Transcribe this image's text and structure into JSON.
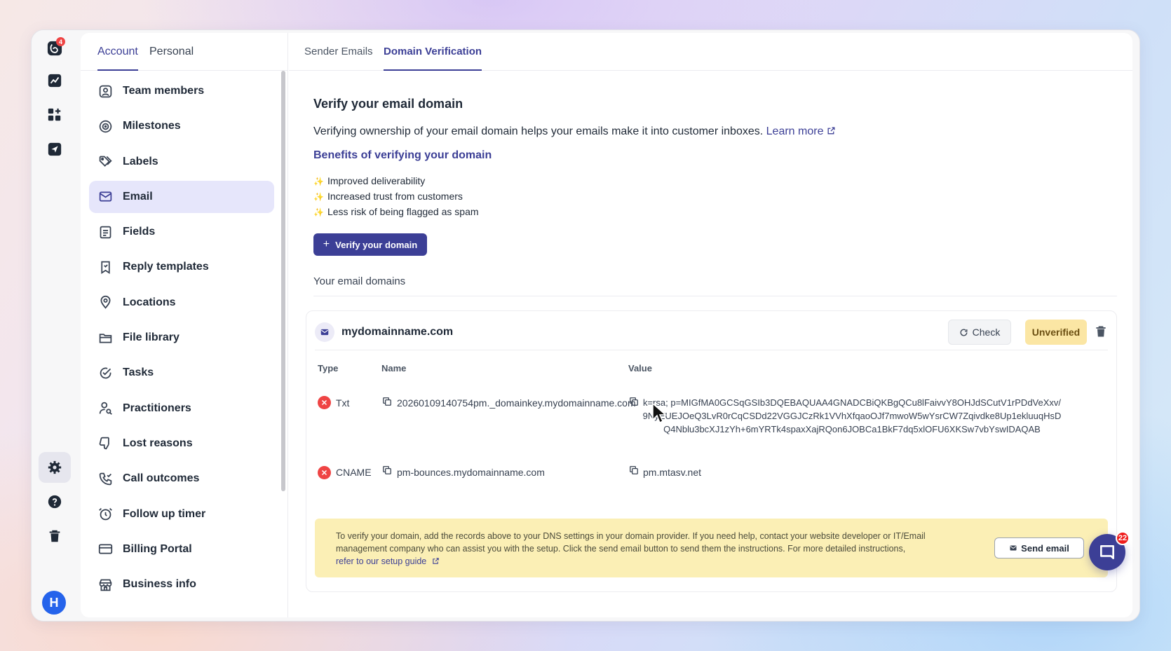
{
  "rail": {
    "logo_badge": "4",
    "avatar_initial": "H"
  },
  "side_tabs": [
    {
      "label": "Account",
      "active": true
    },
    {
      "label": "Personal",
      "active": false
    }
  ],
  "menu": [
    {
      "label": "Team members",
      "icon": "user-square-icon"
    },
    {
      "label": "Milestones",
      "icon": "target-icon"
    },
    {
      "label": "Labels",
      "icon": "tags-icon"
    },
    {
      "label": "Email",
      "icon": "mail-icon",
      "active": true
    },
    {
      "label": "Fields",
      "icon": "form-icon"
    },
    {
      "label": "Reply templates",
      "icon": "bookmark-icon"
    },
    {
      "label": "Locations",
      "icon": "map-pin-icon"
    },
    {
      "label": "File library",
      "icon": "folder-icon"
    },
    {
      "label": "Tasks",
      "icon": "check-circle-icon"
    },
    {
      "label": "Practitioners",
      "icon": "user-search-icon"
    },
    {
      "label": "Lost reasons",
      "icon": "thumbs-down-icon"
    },
    {
      "label": "Call outcomes",
      "icon": "phone-check-icon"
    },
    {
      "label": "Follow up timer",
      "icon": "alarm-clock-icon"
    },
    {
      "label": "Billing Portal",
      "icon": "credit-card-icon"
    },
    {
      "label": "Business info",
      "icon": "store-icon"
    }
  ],
  "content_tabs": [
    {
      "label": "Sender Emails",
      "active": false
    },
    {
      "label": "Domain Verification",
      "active": true
    }
  ],
  "page": {
    "title": "Verify your email domain",
    "description": "Verifying ownership of your email domain helps your emails make it into customer inboxes.",
    "learn_more": "Learn more",
    "benefits_title": "Benefits of verifying your domain",
    "benefits": [
      "Improved deliverability",
      "Increased trust from customers",
      "Less risk of being flagged as spam"
    ],
    "verify_button": "Verify your domain",
    "domains_label": "Your email domains"
  },
  "domain": {
    "name": "mydomainname.com",
    "check_label": "Check",
    "status": "Unverified",
    "columns": {
      "type": "Type",
      "name": "Name",
      "value": "Value"
    },
    "records": [
      {
        "type": "Txt",
        "name": "20260109140754pm._domainkey.mydomainname.com",
        "value_lines": [
          "k=rsa; p=MIGfMA0GCSqGSIb3DQEBAQUAA4GNADCBiQKBgQCu8lFaivvY8OHJdSCutV1rPDdVeXxv/",
          "9NyEUEJOeQ3LvR0rCqCSDd22VGGJCzRk1VVhXfqaoOJf7mwoW5wYsrCW7Zqivdke8Up1ekluuqHsD",
          "Q4Nblu3bcXJ1zYh+6mYRTk4spaxXajRQon6JOBCa1BkF7dq5xlOFU6XKSw7vbYswIDAQAB"
        ]
      },
      {
        "type": "CNAME",
        "name": "pm-bounces.mydomainname.com",
        "value_lines": [
          "pm.mtasv.net"
        ]
      }
    ],
    "notice": "To verify your domain, add the records above to your DNS settings in your domain provider. If you need help, contact your website developer or IT/Email management company who can assist you with the setup. Click the send email button to send them the instructions. For more detailed instructions,",
    "notice_link": "refer to our setup guide",
    "send_email_label": "Send email"
  },
  "chat": {
    "count": "22"
  },
  "colors": {
    "accent": "#3c3f96",
    "unverified_bg": "#fbe6a4",
    "notice_bg": "#fbefb5",
    "error": "#ef4444"
  }
}
